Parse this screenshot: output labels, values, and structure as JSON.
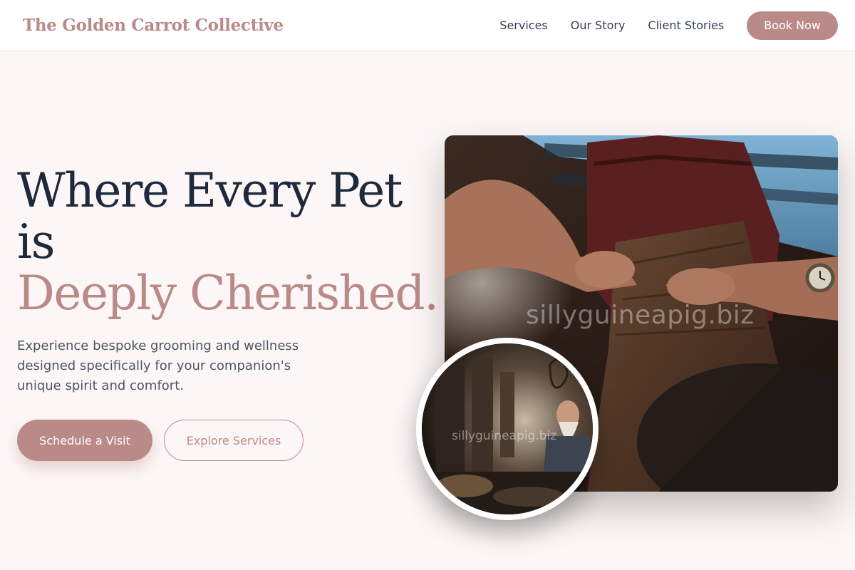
{
  "header": {
    "brand": "The Golden Carrot Collective",
    "nav": [
      "Services",
      "Our Story",
      "Client Stories"
    ],
    "cta_label": "Book Now"
  },
  "hero": {
    "title_line1": "Where Every Pet",
    "title_line2": "is",
    "title_accent": "Deeply Cherished.",
    "subtitle": "Experience bespoke grooming and wellness designed specifically for your companion's unique spirit and comfort.",
    "primary_cta": "Schedule a Visit",
    "secondary_cta": "Explore Services"
  },
  "images": {
    "main_watermark": "sillyguineapig.biz",
    "circle_watermark": "sillyguineapig.biz"
  },
  "colors": {
    "accent": "#b98a88",
    "background": "#fcf7f6",
    "heading": "#1e293b"
  }
}
